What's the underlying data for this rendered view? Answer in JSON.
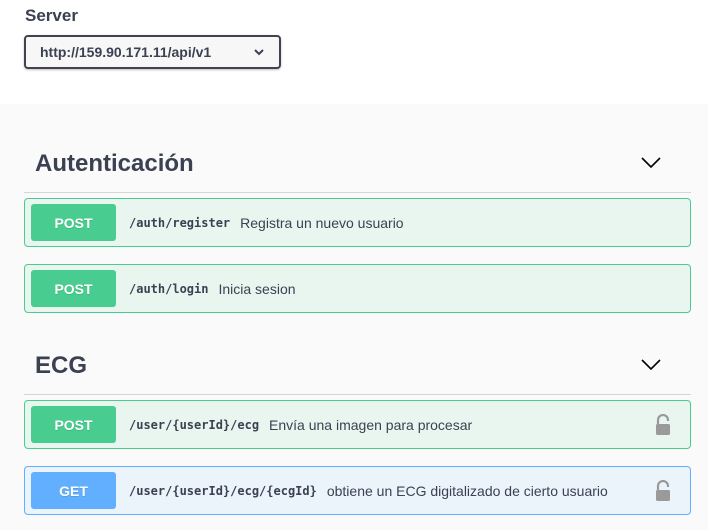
{
  "server": {
    "label": "Server",
    "selected": "http://159.90.171.11/api/v1"
  },
  "tags": [
    {
      "name": "Autenticación",
      "operations": [
        {
          "method": "POST",
          "path": "/auth/register",
          "summary": "Registra un nuevo usuario",
          "locked": false
        },
        {
          "method": "POST",
          "path": "/auth/login",
          "summary": "Inicia sesion",
          "locked": false
        }
      ]
    },
    {
      "name": "ECG",
      "operations": [
        {
          "method": "POST",
          "path": "/user/{userId}/ecg",
          "summary": "Envía una imagen para procesar",
          "locked": true
        },
        {
          "method": "GET",
          "path": "/user/{userId}/ecg/{ecgId}",
          "summary": "obtiene un ECG digitalizado de cierto usuario",
          "locked": true
        }
      ]
    }
  ],
  "colors": {
    "post": "#49cc90",
    "post_bg": "#e9f6f0",
    "get": "#61affe",
    "get_bg": "#ebf3fb",
    "text": "#3b4151"
  },
  "icons": {
    "server_dropdown": "chevron-down-icon",
    "tag_toggle": "chevron-down-icon",
    "auth": "lock-icon"
  }
}
